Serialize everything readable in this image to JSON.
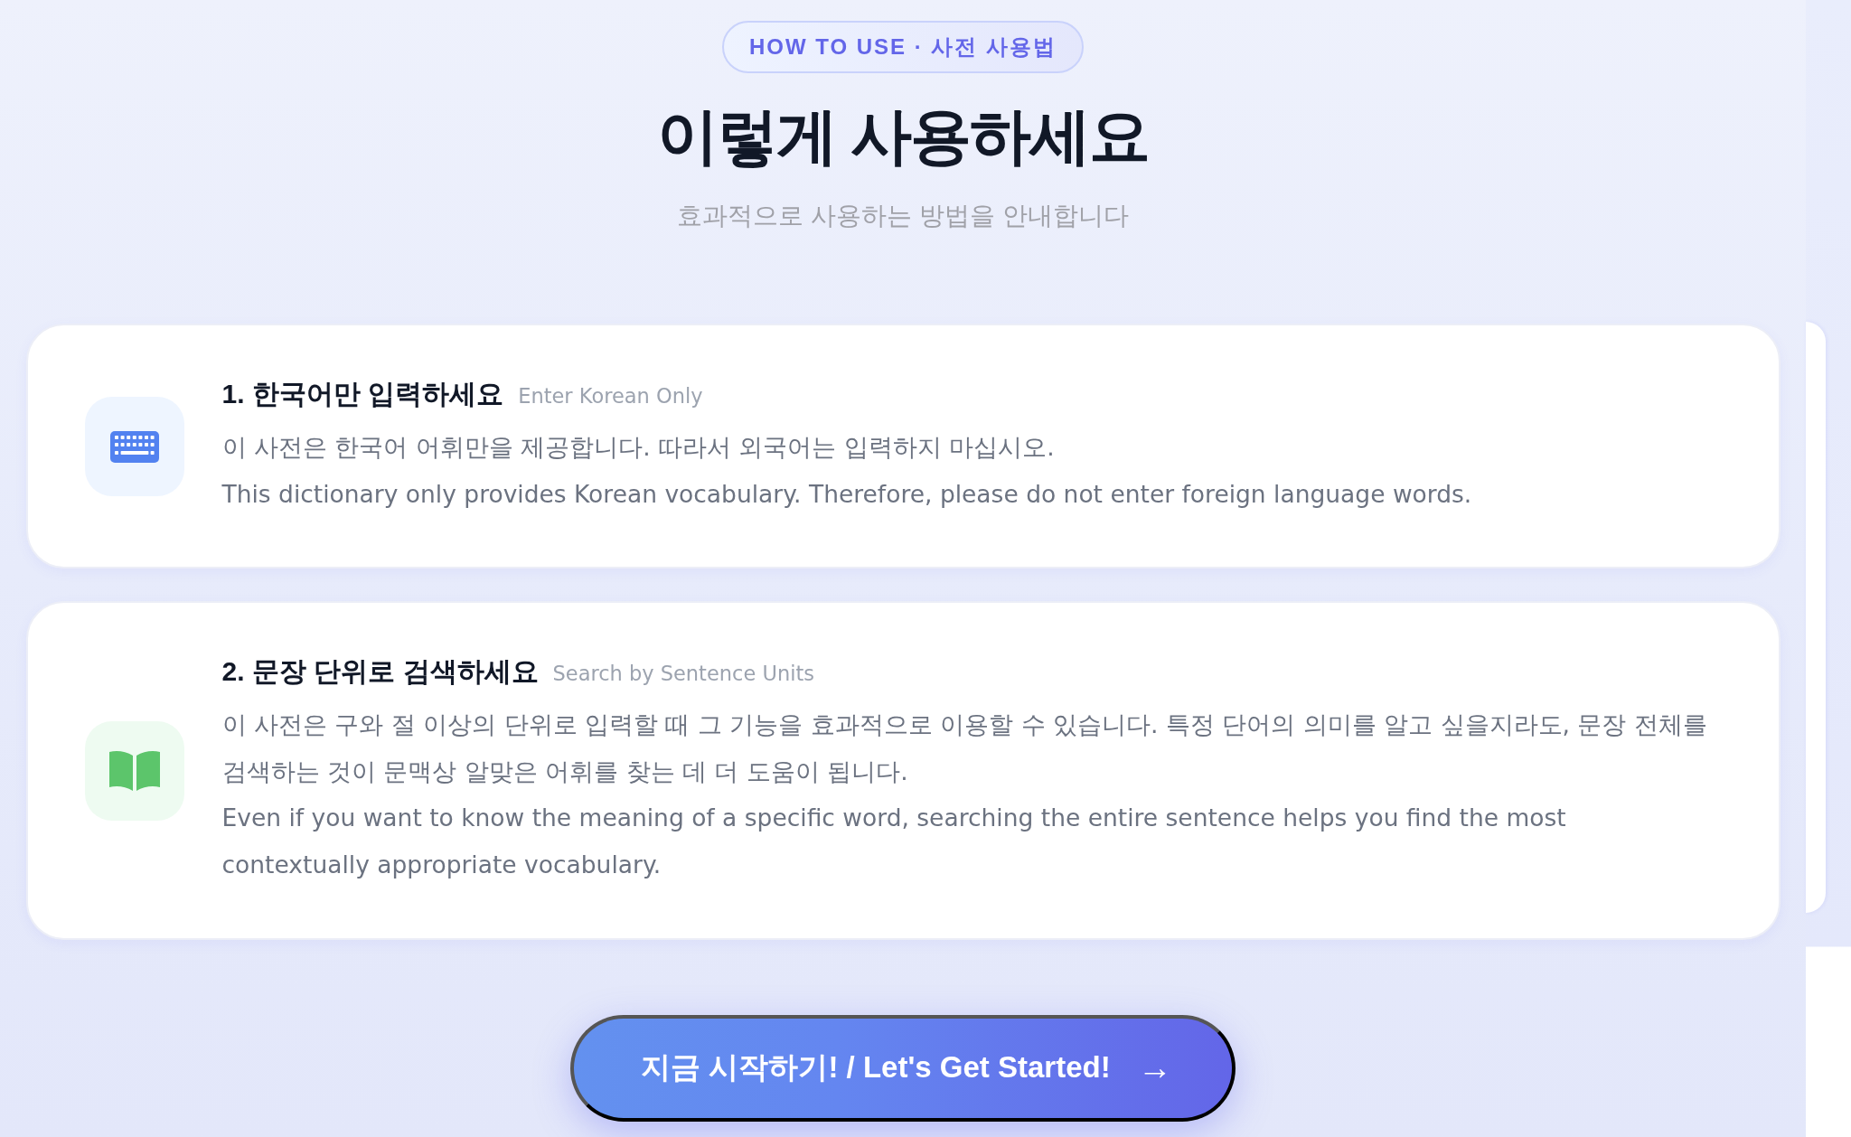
{
  "badge": {
    "text": "HOW TO USE · 사전 사용법"
  },
  "title": "이렇게 사용하세요",
  "subtitle": "효과적으로 사용하는 방법을 안내합니다",
  "steps": [
    {
      "kind": "keyboard",
      "title": "1. 한국어만 입력하세요",
      "subtitle": "Enter Korean Only",
      "paragraphs": [
        "이 사전은 한국어 어휘만을 제공합니다. 따라서 외국어는 입력하지 마십시오.",
        "This dictionary only provides Korean vocabulary. Therefore, please do not enter foreign language words."
      ]
    },
    {
      "kind": "book",
      "title": "2. 문장 단위로 검색하세요",
      "subtitle": "Search by Sentence Units",
      "paragraphs": [
        "이 사전은 구와 절 이상의 단위로 입력할 때 그 기능을 효과적으로 이용할 수 있습니다. 특정 단어의 의미를 알고 싶을지라도, 문장 전체를 검색하는 것이 문맥상 알맞은 어휘를 찾는 데 더 도움이 됩니다.",
        "Even if you want to know the meaning of a specific word, searching the entire sentence helps you find the most contextually appropriate vocabulary."
      ]
    }
  ],
  "cta": {
    "label": "지금 시작하기! / Let's Get Started!",
    "arrow": "→"
  }
}
